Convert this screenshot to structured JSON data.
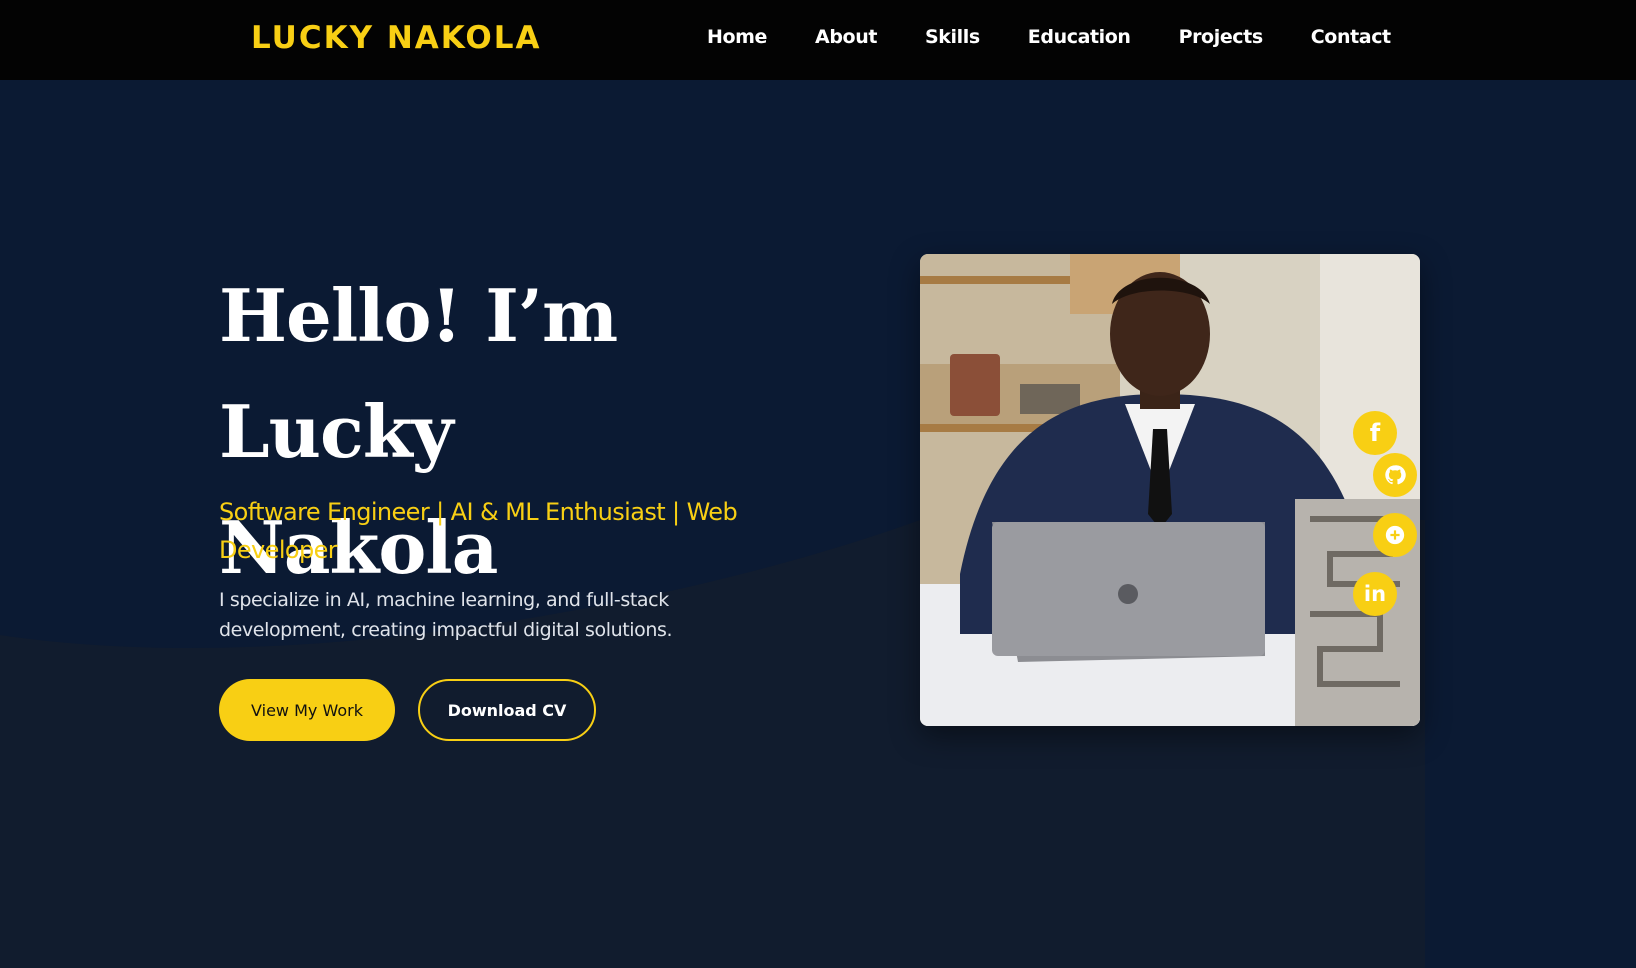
{
  "nav": {
    "brand": "LUCKY NAKOLA",
    "links": [
      "Home",
      "About",
      "Skills",
      "Education",
      "Projects",
      "Contact"
    ]
  },
  "hero": {
    "title_line1": "Hello! I’m Lucky",
    "title_line2": "Nakola",
    "subtitle": "Software Engineer | AI & ML Enthusiast | Web Developer",
    "description": "I specialize in AI, machine learning, and full-stack development, creating impactful digital solutions.",
    "buttons": {
      "primary": "View My Work",
      "secondary": "Download CV"
    }
  },
  "social": {
    "facebook_glyph": "f",
    "linkedin_glyph": "in"
  },
  "colors": {
    "accent": "#f8cf14",
    "navbar": "#030303",
    "background": "#0b1a33"
  },
  "icons": [
    "facebook-icon",
    "github-icon",
    "circle-plus-icon",
    "linkedin-icon"
  ]
}
